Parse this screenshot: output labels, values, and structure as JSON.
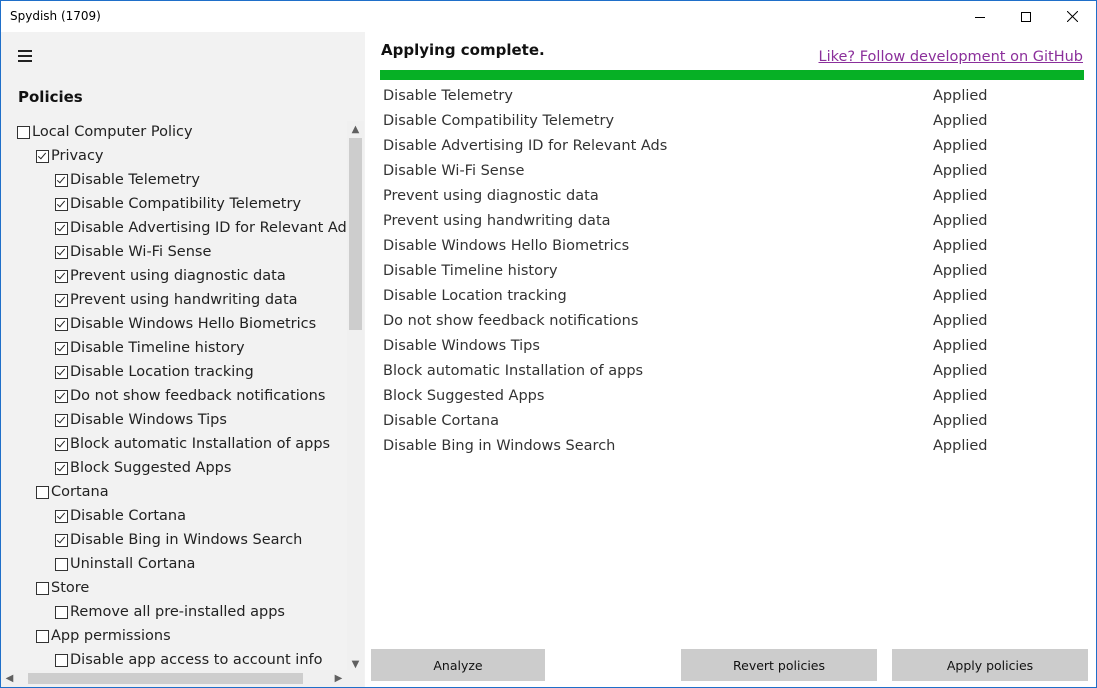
{
  "window": {
    "title": "Spydish (1709)"
  },
  "sidebar": {
    "title": "Policies",
    "tree": [
      {
        "label": "Local Computer Policy",
        "level": 0,
        "checked": false
      },
      {
        "label": "Privacy",
        "level": 1,
        "checked": true
      },
      {
        "label": "Disable Telemetry",
        "level": 2,
        "checked": true
      },
      {
        "label": "Disable Compatibility Telemetry",
        "level": 2,
        "checked": true
      },
      {
        "label": "Disable Advertising ID for Relevant Ads",
        "level": 2,
        "checked": true
      },
      {
        "label": "Disable Wi-Fi Sense",
        "level": 2,
        "checked": true
      },
      {
        "label": "Prevent using diagnostic data",
        "level": 2,
        "checked": true
      },
      {
        "label": "Prevent using handwriting data",
        "level": 2,
        "checked": true
      },
      {
        "label": "Disable Windows Hello Biometrics",
        "level": 2,
        "checked": true
      },
      {
        "label": "Disable Timeline history",
        "level": 2,
        "checked": true
      },
      {
        "label": "Disable Location tracking",
        "level": 2,
        "checked": true
      },
      {
        "label": "Do not show feedback notifications",
        "level": 2,
        "checked": true
      },
      {
        "label": "Disable Windows Tips",
        "level": 2,
        "checked": true
      },
      {
        "label": "Block automatic Installation of apps",
        "level": 2,
        "checked": true
      },
      {
        "label": "Block Suggested Apps",
        "level": 2,
        "checked": true
      },
      {
        "label": "Cortana",
        "level": 1,
        "checked": false
      },
      {
        "label": "Disable Cortana",
        "level": 2,
        "checked": true
      },
      {
        "label": "Disable Bing in Windows Search",
        "level": 2,
        "checked": true
      },
      {
        "label": "Uninstall Cortana",
        "level": 2,
        "checked": false
      },
      {
        "label": "Store",
        "level": 1,
        "checked": false
      },
      {
        "label": "Remove all pre-installed apps",
        "level": 2,
        "checked": false
      },
      {
        "label": "App permissions",
        "level": 1,
        "checked": false
      },
      {
        "label": "Disable app access to account info",
        "level": 2,
        "checked": false
      }
    ]
  },
  "main": {
    "status": "Applying complete.",
    "github_link": "Like? Follow development on GitHub",
    "progress_percent": 100,
    "results": [
      {
        "name": "Disable Telemetry",
        "status": "Applied"
      },
      {
        "name": "Disable Compatibility Telemetry",
        "status": "Applied"
      },
      {
        "name": "Disable Advertising ID for Relevant Ads",
        "status": "Applied"
      },
      {
        "name": "Disable Wi-Fi Sense",
        "status": "Applied"
      },
      {
        "name": "Prevent using diagnostic data",
        "status": "Applied"
      },
      {
        "name": "Prevent using handwriting data",
        "status": "Applied"
      },
      {
        "name": "Disable Windows Hello Biometrics",
        "status": "Applied"
      },
      {
        "name": "Disable Timeline history",
        "status": "Applied"
      },
      {
        "name": "Disable Location tracking",
        "status": "Applied"
      },
      {
        "name": "Do not show feedback notifications",
        "status": "Applied"
      },
      {
        "name": "Disable Windows Tips",
        "status": "Applied"
      },
      {
        "name": "Block automatic Installation of apps",
        "status": "Applied"
      },
      {
        "name": "Block Suggested Apps",
        "status": "Applied"
      },
      {
        "name": "Disable Cortana",
        "status": "Applied"
      },
      {
        "name": "Disable Bing in Windows Search",
        "status": "Applied"
      }
    ]
  },
  "buttons": {
    "analyze": "Analyze",
    "revert": "Revert policies",
    "apply": "Apply policies"
  },
  "colors": {
    "progress": "#06b025",
    "link": "#8b2f9b",
    "window_border": "#1f6fc9"
  }
}
